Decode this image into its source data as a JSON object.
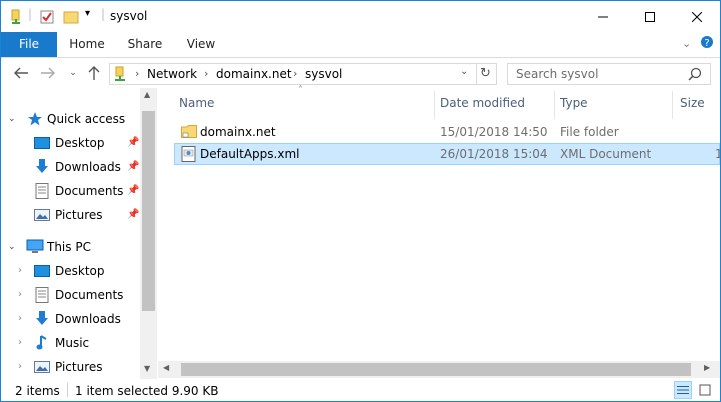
{
  "window": {
    "title": "sysvol"
  },
  "ribbon": {
    "tabs": [
      {
        "label": "File"
      },
      {
        "label": "Home"
      },
      {
        "label": "Share"
      },
      {
        "label": "View"
      }
    ]
  },
  "address": {
    "crumbs": [
      "Network",
      "domainx.net",
      "sysvol"
    ]
  },
  "search": {
    "placeholder": "Search sysvol"
  },
  "nav": {
    "quick_access": "Quick access",
    "quick_items": [
      "Desktop",
      "Downloads",
      "Documents",
      "Pictures"
    ],
    "this_pc": "This PC",
    "pc_items": [
      "Desktop",
      "Documents",
      "Downloads",
      "Music",
      "Pictures"
    ]
  },
  "columns": {
    "name": "Name",
    "date": "Date modified",
    "type": "Type",
    "size": "Size"
  },
  "files": [
    {
      "name": "domainx.net",
      "date": "15/01/2018 14:50",
      "type": "File folder",
      "size": ""
    },
    {
      "name": "DefaultApps.xml",
      "date": "26/01/2018 15:04",
      "type": "XML Document",
      "size": "1"
    }
  ],
  "status": {
    "count": "2 items",
    "selection": "1 item selected  9.90 KB"
  },
  "colors": {
    "accent": "#1979ca",
    "selection": "#cce8ff",
    "folder": "#f8d775"
  }
}
